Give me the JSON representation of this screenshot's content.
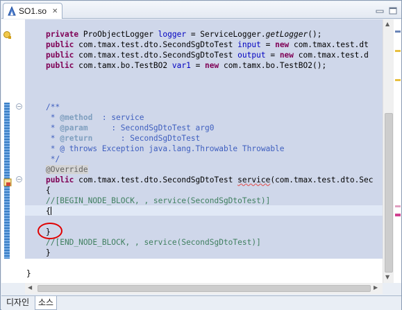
{
  "tab": {
    "title": "SO1.so",
    "close_glyph": "✕"
  },
  "code": {
    "line1": {
      "kw": "private",
      "type": " ProObjectLogger ",
      "field": "logger",
      "eq": " = ServiceLogger.",
      "method": "getLogger",
      "rest": "();"
    },
    "line2": {
      "kw": "public",
      "type": " com.tmax.test.dto.SecondSgDtoTest ",
      "field": "input",
      "eq": " = ",
      "kw2": "new",
      "rest": " com.tmax.test.dt"
    },
    "line3": {
      "kw": "public",
      "type": " com.tmax.test.dto.SecondSgDtoTest ",
      "field": "output",
      "eq": " = ",
      "kw2": "new",
      "rest": " com.tmax.test.d"
    },
    "line4": {
      "kw": "public",
      "type": " com.tamx.bo.TestBO2 ",
      "field": "var1",
      "eq": " = ",
      "kw2": "new",
      "rest": " com.tamx.bo.TestBO2();"
    },
    "doc_open": "/**",
    "doc_method_tag": "@method",
    "doc_method_text": "  : service",
    "doc_param_tag": "@param",
    "doc_param_text": "     : SecondSgDtoTest arg0",
    "doc_return_tag": "@return",
    "doc_return_text": "      : SecondSgDtoTest",
    "doc_star": " * ",
    "doc_throws": "@ throws Exception java.lang.Throwable Throwable",
    "doc_close": " */",
    "annotation": "@Override",
    "sig": {
      "kw": "public",
      "type": " com.tmax.test.dto.SecondSgDtoTest ",
      "name": "service",
      "rest": "(com.tmax.test.dto.Sec"
    },
    "brace_open": "{",
    "begin_comment": "//[BEGIN_NODE_BLOCK, , service(SecondSgDtoTest)]",
    "inner_open": "{",
    "inner_close": "}",
    "end_comment": "//[END_NODE_BLOCK, , service(SecondSgDtoTest)]",
    "brace_close": "}",
    "class_close": "}"
  },
  "bottom_tabs": {
    "design": "디자인",
    "source": "소스"
  },
  "colors": {
    "keyword": "#7f0055",
    "field": "#0000c0",
    "comment": "#3f7f5f",
    "javadoc": "#3f5fbf",
    "highlight": "#cfd7ea",
    "annotation_circle": "#e00000"
  },
  "icons": [
    "file-java-icon",
    "close-icon",
    "minimize-icon",
    "maximize-icon",
    "warning-icon",
    "error-icon",
    "fold-icon"
  ]
}
